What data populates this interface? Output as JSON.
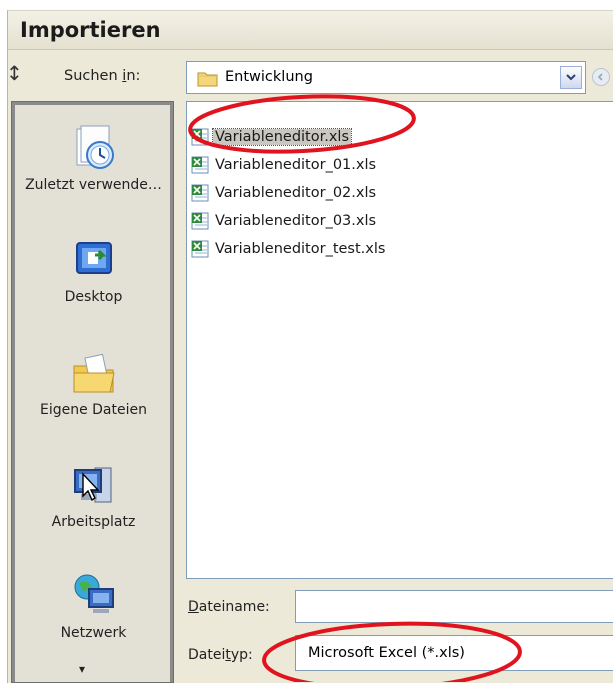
{
  "dialog": {
    "title": "Importieren",
    "look_in": {
      "label_pre": "Suchen ",
      "label_key": "i",
      "label_post": "n:",
      "value": "Entwicklung"
    },
    "places": [
      {
        "label": "Zuletzt verwende…",
        "icon": "recent-icon"
      },
      {
        "label": "Desktop",
        "icon": "desktop-icon"
      },
      {
        "label": "Eigene Dateien",
        "icon": "my-documents-icon"
      },
      {
        "label": "Arbeitsplatz",
        "icon": "my-computer-icon"
      },
      {
        "label": "Netzwerk",
        "icon": "network-icon"
      }
    ],
    "places_more": "▾",
    "files": [
      {
        "name": "Variableneditor.xls",
        "selected": true
      },
      {
        "name": "Variableneditor_01.xls",
        "selected": false
      },
      {
        "name": "Variableneditor_02.xls",
        "selected": false
      },
      {
        "name": "Variableneditor_03.xls",
        "selected": false
      },
      {
        "name": "Variableneditor_test.xls",
        "selected": false
      }
    ],
    "filename": {
      "label_key": "D",
      "label_post": "ateiname:",
      "value": ""
    },
    "filetype": {
      "label_pre": "Datei",
      "label_key": "t",
      "label_post": "yp:",
      "value": "Microsoft Excel (*.xls)"
    }
  },
  "colors": {
    "annotation": "#e0141e",
    "dialog_bg": "#ece9d8",
    "excel_green": "#2e8b3a"
  }
}
